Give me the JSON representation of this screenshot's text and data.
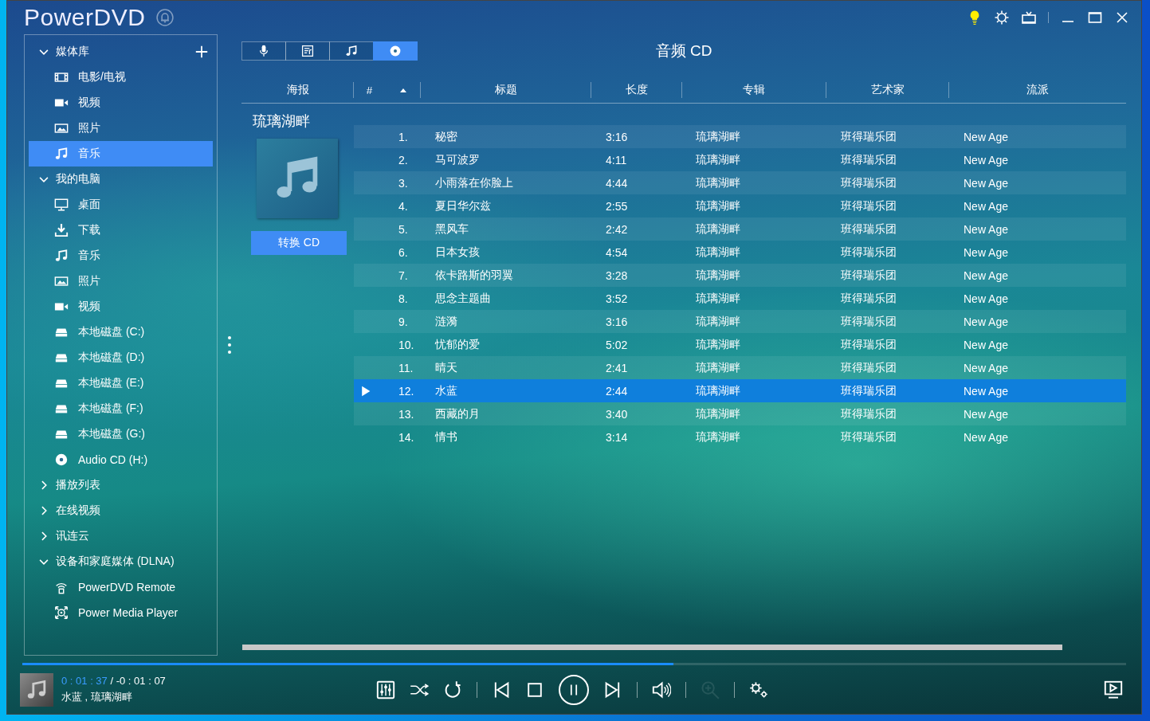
{
  "window": {
    "title": "PowerDVD"
  },
  "title_bar_buttons": [
    {
      "kind": "bulb"
    },
    {
      "kind": "settings"
    },
    {
      "kind": "tv"
    },
    {
      "kind": "divider"
    },
    {
      "kind": "minimize"
    },
    {
      "kind": "maximize"
    },
    {
      "kind": "close"
    }
  ],
  "sidebar": {
    "sections": [
      {
        "label": "媒体库",
        "expanded": true,
        "addable": true,
        "items": [
          {
            "label": "电影/电视",
            "kind": "film",
            "selected": false
          },
          {
            "label": "视频",
            "kind": "video",
            "selected": false
          },
          {
            "label": "照片",
            "kind": "photo",
            "selected": false
          },
          {
            "label": "音乐",
            "kind": "music",
            "selected": true
          }
        ]
      },
      {
        "label": "我的电脑",
        "expanded": true,
        "items": [
          {
            "label": "桌面",
            "kind": "monitor",
            "selected": false
          },
          {
            "label": "下载",
            "kind": "download",
            "selected": false
          },
          {
            "label": "音乐",
            "kind": "music",
            "selected": false
          },
          {
            "label": "照片",
            "kind": "photo",
            "selected": false
          },
          {
            "label": "视频",
            "kind": "video",
            "selected": false
          },
          {
            "label": "本地磁盘 (C:)",
            "kind": "drive",
            "selected": false
          },
          {
            "label": "本地磁盘 (D:)",
            "kind": "drive",
            "selected": false
          },
          {
            "label": "本地磁盘 (E:)",
            "kind": "drive",
            "selected": false
          },
          {
            "label": "本地磁盘 (F:)",
            "kind": "drive",
            "selected": false
          },
          {
            "label": "本地磁盘 (G:)",
            "kind": "drive",
            "selected": false
          },
          {
            "label": "Audio CD (H:)",
            "kind": "disc",
            "selected": false
          }
        ]
      },
      {
        "label": "播放列表",
        "expanded": false
      },
      {
        "label": "在线视频",
        "expanded": false
      },
      {
        "label": "讯连云",
        "expanded": false
      },
      {
        "label": "设备和家庭媒体 (DLNA)",
        "expanded": true,
        "items": [
          {
            "label": "PowerDVD Remote",
            "kind": "remote",
            "selected": false
          },
          {
            "label": "Power Media Player",
            "kind": "media-player",
            "selected": false
          }
        ]
      }
    ]
  },
  "view_tabs": [
    {
      "kind": "mic",
      "selected": false
    },
    {
      "kind": "lyrics",
      "selected": false
    },
    {
      "kind": "music",
      "selected": false
    },
    {
      "kind": "disc",
      "selected": true
    }
  ],
  "page_title": "音频 CD",
  "table": {
    "columns": [
      {
        "label": "海报",
        "sorted": false
      },
      {
        "label": "#",
        "sorted": true
      },
      {
        "label": "标题",
        "sorted": false
      },
      {
        "label": "长度",
        "sorted": false
      },
      {
        "label": "专辑",
        "sorted": false
      },
      {
        "label": "艺术家",
        "sorted": false
      },
      {
        "label": "流派",
        "sorted": false
      }
    ],
    "album": {
      "title": "琉璃湖畔",
      "button": "转换 CD"
    },
    "rows": [
      {
        "number": "1.",
        "title": "秘密",
        "length": "3:16",
        "album": "琉璃湖畔",
        "artist": "班得瑞乐团",
        "genre": "New Age",
        "selected": false,
        "playing": false
      },
      {
        "number": "2.",
        "title": "马可波罗",
        "length": "4:11",
        "album": "琉璃湖畔",
        "artist": "班得瑞乐团",
        "genre": "New Age",
        "selected": false,
        "playing": false
      },
      {
        "number": "3.",
        "title": "小雨落在你脸上",
        "length": "4:44",
        "album": "琉璃湖畔",
        "artist": "班得瑞乐团",
        "genre": "New Age",
        "selected": false,
        "playing": false
      },
      {
        "number": "4.",
        "title": "夏日华尔兹",
        "length": "2:55",
        "album": "琉璃湖畔",
        "artist": "班得瑞乐团",
        "genre": "New Age",
        "selected": false,
        "playing": false
      },
      {
        "number": "5.",
        "title": "黑风车",
        "length": "2:42",
        "album": "琉璃湖畔",
        "artist": "班得瑞乐团",
        "genre": "New Age",
        "selected": false,
        "playing": false
      },
      {
        "number": "6.",
        "title": "日本女孩",
        "length": "4:54",
        "album": "琉璃湖畔",
        "artist": "班得瑞乐团",
        "genre": "New Age",
        "selected": false,
        "playing": false
      },
      {
        "number": "7.",
        "title": "依卡路斯的羽翼",
        "length": "3:28",
        "album": "琉璃湖畔",
        "artist": "班得瑞乐团",
        "genre": "New Age",
        "selected": false,
        "playing": false
      },
      {
        "number": "8.",
        "title": "思念主题曲",
        "length": "3:52",
        "album": "琉璃湖畔",
        "artist": "班得瑞乐团",
        "genre": "New Age",
        "selected": false,
        "playing": false
      },
      {
        "number": "9.",
        "title": "涟漪",
        "length": "3:16",
        "album": "琉璃湖畔",
        "artist": "班得瑞乐团",
        "genre": "New Age",
        "selected": false,
        "playing": false
      },
      {
        "number": "10.",
        "title": "忧郁的爱",
        "length": "5:02",
        "album": "琉璃湖畔",
        "artist": "班得瑞乐团",
        "genre": "New Age",
        "selected": false,
        "playing": false
      },
      {
        "number": "11.",
        "title": "晴天",
        "length": "2:41",
        "album": "琉璃湖畔",
        "artist": "班得瑞乐团",
        "genre": "New Age",
        "selected": false,
        "playing": false
      },
      {
        "number": "12.",
        "title": "水蓝",
        "length": "2:44",
        "album": "琉璃湖畔",
        "artist": "班得瑞乐团",
        "genre": "New Age",
        "selected": true,
        "playing": true
      },
      {
        "number": "13.",
        "title": "西藏的月",
        "length": "3:40",
        "album": "琉璃湖畔",
        "artist": "班得瑞乐团",
        "genre": "New Age",
        "selected": false,
        "playing": false
      },
      {
        "number": "14.",
        "title": "情书",
        "length": "3:14",
        "album": "琉璃湖畔",
        "artist": "班得瑞乐团",
        "genre": "New Age",
        "selected": false,
        "playing": false
      }
    ]
  },
  "player": {
    "level": 0.59,
    "elapsed": "0 : 01 : 37",
    "separator": "/",
    "remaining": "-0 : 01 : 07",
    "now_playing": "水蓝 , 琉璃湖畔",
    "playing": true,
    "controls": [
      {
        "kind": "equalizer",
        "disabled": false
      },
      {
        "kind": "shuffle",
        "disabled": false
      },
      {
        "kind": "repeat",
        "disabled": false
      },
      {
        "kind": "divider"
      },
      {
        "kind": "previous",
        "disabled": false
      },
      {
        "kind": "stop",
        "disabled": false
      },
      {
        "kind": "play-pause"
      },
      {
        "kind": "next",
        "disabled": false
      },
      {
        "kind": "divider"
      },
      {
        "kind": "volume",
        "disabled": false
      },
      {
        "kind": "divider"
      },
      {
        "kind": "zoom",
        "disabled": true
      },
      {
        "kind": "divider"
      },
      {
        "kind": "settings",
        "disabled": false
      }
    ]
  }
}
